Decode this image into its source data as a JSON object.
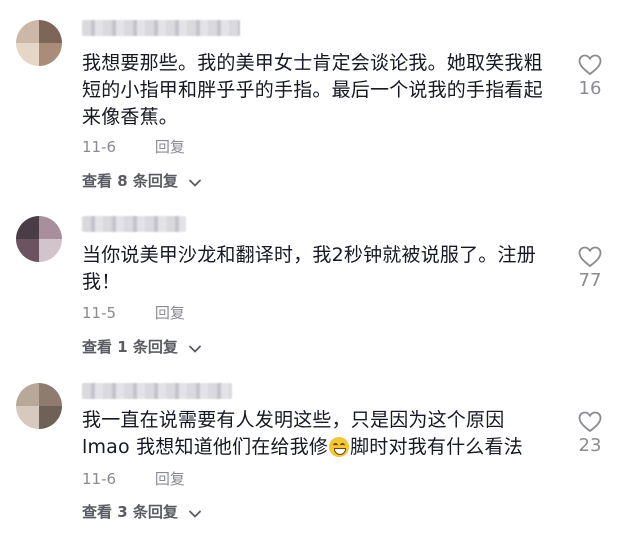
{
  "comments": [
    {
      "text": "我想要那些。我的美甲女士肯定会谈论我。她取笑我粗短的小指甲和胖乎乎的手指。最后一个说我的手指看起来像香蕉。",
      "date": "11-6",
      "reply_label": "回复",
      "view_replies": "查看 8 条回复",
      "likes": "16",
      "avatar_colors": [
        "#cdb7a7",
        "#7d6657",
        "#e6d6c8",
        "#a98c7a"
      ]
    },
    {
      "text": "当你说美甲沙龙和翻译时，我2秒钟就被说服了。注册我！",
      "date": "11-5",
      "reply_label": "回复",
      "view_replies": "查看 1 条回复",
      "likes": "77",
      "avatar_colors": [
        "#4a3d46",
        "#a78f9c",
        "#6c5360",
        "#d3c4cb"
      ]
    },
    {
      "text_a": "我一直在说需要有人发明这些，只是因为这个原因 lmao 我想知道他们在给我修",
      "text_b": "脚时对我有什么看法",
      "emoji": "grinning-sweat-emoji",
      "date": "11-6",
      "reply_label": "回复",
      "view_replies": "查看 3 条回复",
      "likes": "23",
      "avatar_colors": [
        "#b8a899",
        "#8d7c6f",
        "#d6c9bd",
        "#6f6158"
      ]
    }
  ],
  "icons": {
    "like": "heart-outline-icon",
    "expand": "chevron-down-icon"
  },
  "colors": {
    "text": "#161823",
    "secondary": "#8a8b91",
    "view_replies": "#5b5c63"
  }
}
